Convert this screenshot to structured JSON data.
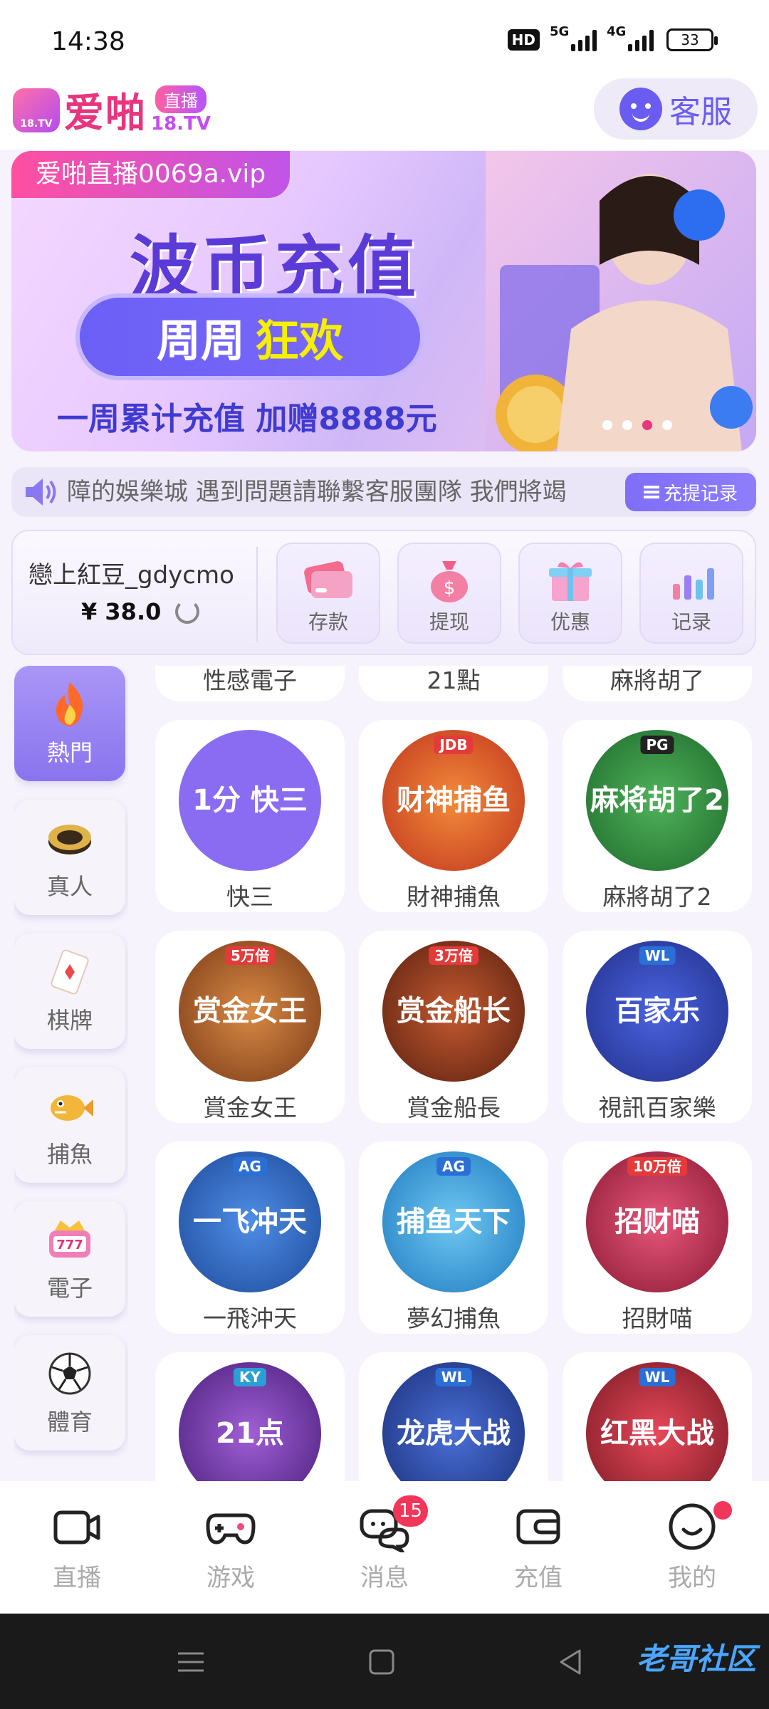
{
  "status_bar": {
    "time": "14:38",
    "hd": "HD",
    "net1": "5G",
    "net2": "4G",
    "battery": "33"
  },
  "header": {
    "logo_badge": "18.TV",
    "logo_text": "爱啪",
    "logo_sub_top": "直播",
    "logo_sub_bottom": "18.TV",
    "service_label": "客服"
  },
  "banner": {
    "url_text": "爱啪直播0069a.vip",
    "title": "波币充值",
    "pill_white": "周周",
    "pill_yellow": "狂欢",
    "promo": "一周累计充值 加赠8888元",
    "dots": 4,
    "active_dot": 2
  },
  "marquee": {
    "text": "障的娛樂城  遇到問題請聯繫客服團隊 我們將竭",
    "deposit_record_label": "充提记录"
  },
  "account": {
    "username": "戀上紅豆_gdycmo",
    "balance": "¥ 38.0",
    "actions": [
      {
        "label": "存款",
        "icon": "card-icon"
      },
      {
        "label": "提现",
        "icon": "money-bag-icon"
      },
      {
        "label": "优惠",
        "icon": "gift-icon"
      },
      {
        "label": "记录",
        "icon": "bar-chart-icon"
      }
    ]
  },
  "sidebar": {
    "items": [
      {
        "label": "熱門",
        "icon": "fire-icon",
        "active": true
      },
      {
        "label": "真人",
        "icon": "chip-icon",
        "active": false
      },
      {
        "label": "棋牌",
        "icon": "playing-card-icon",
        "active": false
      },
      {
        "label": "捕魚",
        "icon": "fish-icon",
        "active": false
      },
      {
        "label": "電子",
        "icon": "slot-icon",
        "active": false
      },
      {
        "label": "體育",
        "icon": "soccer-ball-icon",
        "active": false
      }
    ]
  },
  "games": {
    "top_partial": [
      "性感電子",
      "21點",
      "麻將胡了"
    ],
    "rows": [
      [
        {
          "name": "快三",
          "art": "1分 快三",
          "color": "#8a6cf2",
          "tag": ""
        },
        {
          "name": "財神捕魚",
          "art": "财神捕鱼",
          "color": "#e0582a",
          "tag": "JDB"
        },
        {
          "name": "麻將胡了2",
          "art": "麻将胡了2",
          "color": "#2f8d3b",
          "tag": "PG"
        }
      ],
      [
        {
          "name": "賞金女王",
          "art": "赏金女王",
          "color": "#b4622b",
          "tag": "5万倍"
        },
        {
          "name": "賞金船長",
          "art": "赏金船长",
          "color": "#8d3b22",
          "tag": "3万倍"
        },
        {
          "name": "視訊百家樂",
          "art": "百家乐",
          "color": "#3b4fc8",
          "tag": "WL"
        }
      ],
      [
        {
          "name": "一飛沖天",
          "art": "一飞冲天",
          "color": "#2f6fd0",
          "tag": "AG"
        },
        {
          "name": "夢幻捕魚",
          "art": "捕鱼天下",
          "color": "#3aa7e6",
          "tag": "AG"
        },
        {
          "name": "招財喵",
          "art": "招财喵",
          "color": "#c9304c",
          "tag": "10万倍"
        }
      ],
      [
        {
          "name": "",
          "art": "21点",
          "color": "#7a3fb0",
          "tag": "KY"
        },
        {
          "name": "",
          "art": "龙虎大战",
          "color": "#2a4fa8",
          "tag": "WL"
        },
        {
          "name": "",
          "art": "红黑大战",
          "color": "#c62f3b",
          "tag": "WL"
        }
      ]
    ]
  },
  "bottom_nav": [
    {
      "label": "直播",
      "icon": "camera-icon"
    },
    {
      "label": "游戏",
      "icon": "gamepad-icon"
    },
    {
      "label": "消息",
      "icon": "chat-icon",
      "badge": "15"
    },
    {
      "label": "充值",
      "icon": "wallet-icon"
    },
    {
      "label": "我的",
      "icon": "profile-icon",
      "dot": true
    }
  ],
  "watermark": "老哥社区"
}
